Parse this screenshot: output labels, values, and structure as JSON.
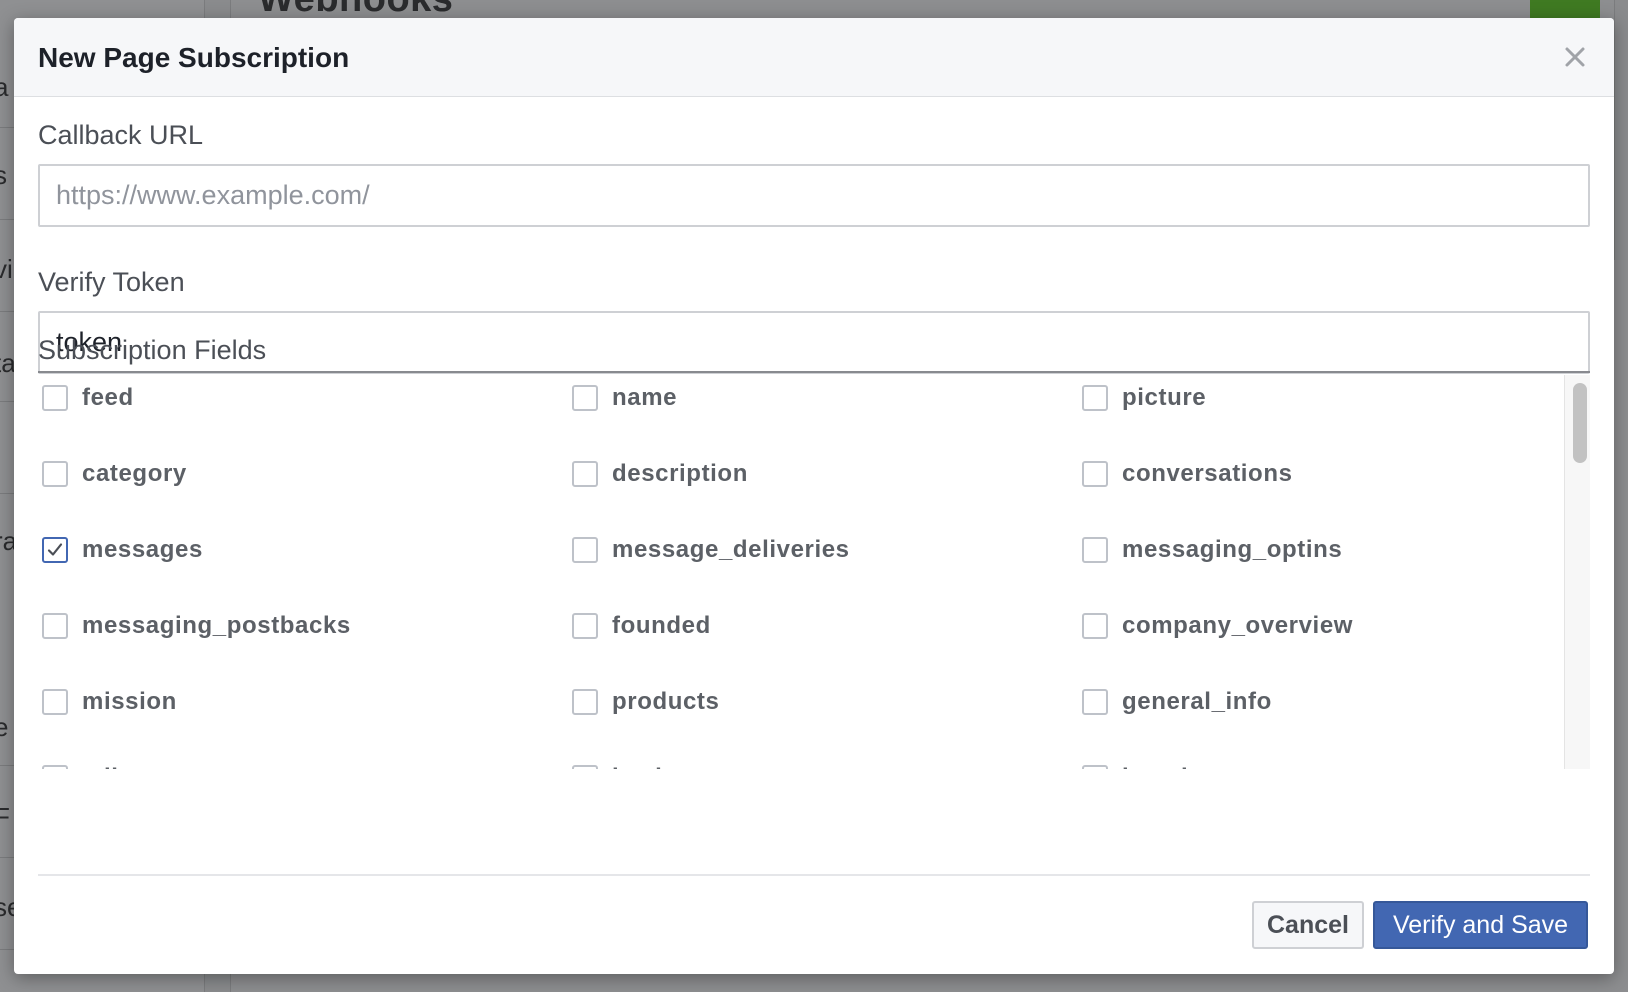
{
  "background": {
    "heading": "Webhooks",
    "sidebar_fragments": [
      "a",
      "s",
      "vi",
      "ta",
      "ra",
      "e",
      "F",
      "se"
    ]
  },
  "modal": {
    "title": "New Page Subscription",
    "callback": {
      "label": "Callback URL",
      "value": "",
      "placeholder": "https://www.example.com/"
    },
    "verify_token": {
      "label": "Verify Token",
      "value": "token",
      "placeholder": ""
    },
    "subscription_fields": {
      "label": "Subscription Fields",
      "rows": [
        [
          {
            "name": "feed",
            "checked": false
          },
          {
            "name": "name",
            "checked": false
          },
          {
            "name": "picture",
            "checked": false
          }
        ],
        [
          {
            "name": "category",
            "checked": false
          },
          {
            "name": "description",
            "checked": false
          },
          {
            "name": "conversations",
            "checked": false
          }
        ],
        [
          {
            "name": "messages",
            "checked": true
          },
          {
            "name": "message_deliveries",
            "checked": false
          },
          {
            "name": "messaging_optins",
            "checked": false
          }
        ],
        [
          {
            "name": "messaging_postbacks",
            "checked": false
          },
          {
            "name": "founded",
            "checked": false
          },
          {
            "name": "company_overview",
            "checked": false
          }
        ],
        [
          {
            "name": "mission",
            "checked": false
          },
          {
            "name": "products",
            "checked": false
          },
          {
            "name": "general_info",
            "checked": false
          }
        ],
        [
          {
            "name": "milestone",
            "checked": false
          },
          {
            "name": "leadgen",
            "checked": false
          },
          {
            "name": "location",
            "checked": false
          }
        ]
      ]
    },
    "buttons": {
      "cancel": "Cancel",
      "primary": "Verify and Save"
    },
    "colors": {
      "primary": "#4267b2",
      "header_bg": "#f6f7f9"
    }
  }
}
